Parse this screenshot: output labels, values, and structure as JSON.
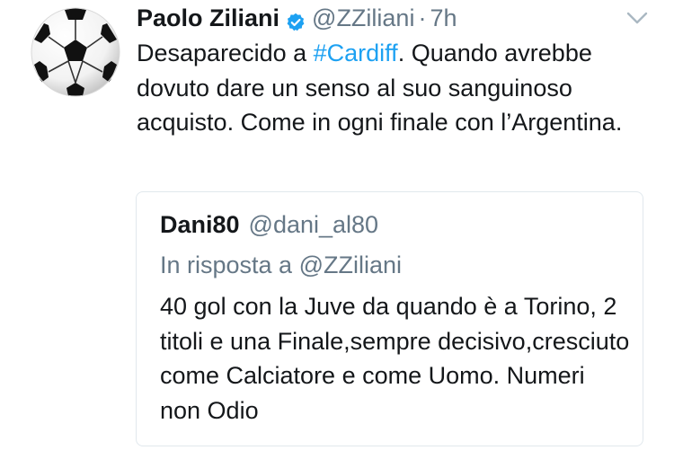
{
  "tweet": {
    "author": {
      "display_name": "Paolo Ziliani",
      "handle": "@ZZiliani",
      "verified": true,
      "avatar": "soccer-ball-avatar"
    },
    "separator": "·",
    "timestamp": "7h",
    "menu_icon": "chevron-down-icon",
    "text": {
      "before_hashtag": "Desaparecido a ",
      "hashtag": "#Cardiff",
      "after_hashtag": ". Quando avrebbe dovuto dare un senso al suo sanguinoso acquisto. Come in ogni finale con l’Argentina."
    },
    "colors": {
      "link": "#1da1f2",
      "secondary_text": "#657786",
      "border": "#e1e8ed"
    }
  },
  "quoted_tweet": {
    "display_name": "Dani80",
    "handle": "@dani_al80",
    "reply_context": "In risposta a @ZZiliani",
    "text": "40 gol con la Juve da quando è a Torino, 2 titoli e una Finale,sempre decisivo,cresciuto  come Calciatore e come Uomo. Numeri non Odio"
  }
}
